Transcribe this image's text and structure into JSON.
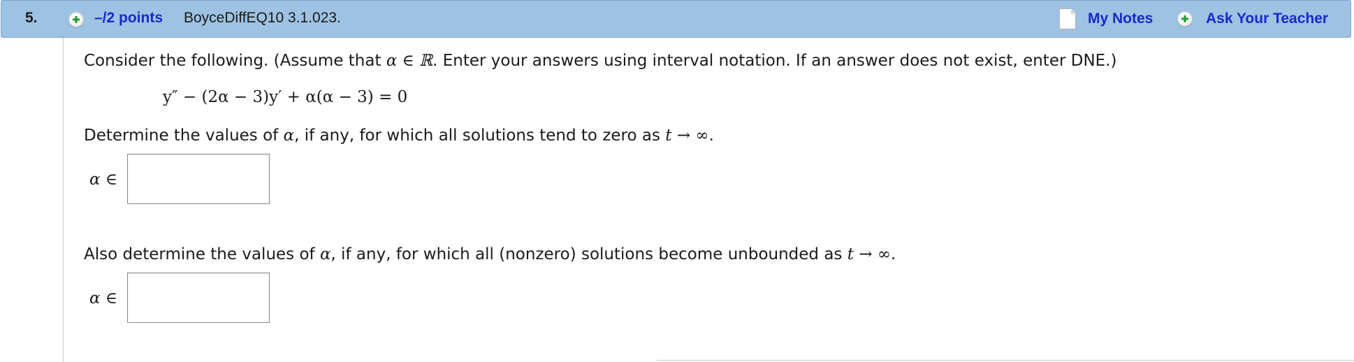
{
  "header": {
    "question_number": "5.",
    "points_label": "–/2 points",
    "question_id": "BoyceDiffEQ10 3.1.023.",
    "my_notes_label": "My Notes",
    "ask_teacher_label": "Ask Your Teacher"
  },
  "question": {
    "intro_prefix": "Consider the following. (Assume that ",
    "intro_condition": "α ∈ ℝ",
    "intro_suffix": ".  Enter your answers using interval notation. If an answer does not exist, enter DNE.)",
    "equation": "y″ − (2α − 3)y′ + α(α − 3) = 0",
    "part1_prefix": "Determine the values of ",
    "part1_alpha": "α",
    "part1_suffix": ", if any, for which all solutions tend to zero as ",
    "part1_limit": "t → ∞",
    "part1_end": ".",
    "part1_answer_label": "α ∈",
    "part1_answer_value": "",
    "part2_prefix": "Also determine the values of ",
    "part2_alpha": "α",
    "part2_suffix": ", if any, for which all (nonzero) solutions become unbounded as ",
    "part2_limit": "t → ∞",
    "part2_end": ".",
    "part2_answer_label": "α ∈",
    "part2_answer_value": ""
  },
  "icons": {
    "expand_points": "plus-icon",
    "notes": "note-icon",
    "ask_teacher": "plus-icon"
  },
  "colors": {
    "header_background": "#9ec2e2",
    "link_blue": "#1729c9",
    "plus_green": "#1f9a2c"
  }
}
